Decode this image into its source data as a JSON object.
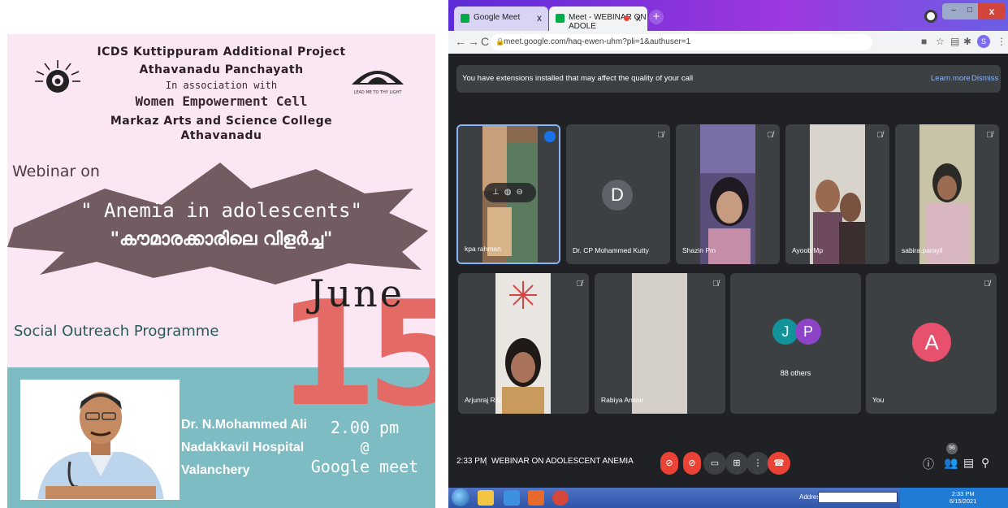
{
  "poster": {
    "line1": "ICDS Kuttippuram Additional Project",
    "line2": "Athavanadu Panchayath",
    "line3": "In association with",
    "line4": "Women Empowerment Cell",
    "line5": "Markaz Arts and Science College",
    "line6": "Athavanadu",
    "logo_right_text": "LEAD ME TO THY LIGHT",
    "webinar_on": "Webinar on",
    "topic_en": "\" Anemia in adolescents\"",
    "topic_ml": "\"കൗമാരക്കാരിലെ  വിളർച്ച\"",
    "month": "June",
    "day": "15",
    "outreach": "Social Outreach Programme",
    "doctor_name": "Dr. N.Mohammed Ali",
    "hospital": "Nadakkavil Hospital",
    "place": "Valanchery",
    "time": "2.00 pm",
    "at": "@",
    "platform": "Google meet",
    "colors": {
      "background": "#fbe6f3",
      "teal": "#7ebcc4",
      "accent": "#e46a66"
    }
  },
  "browser": {
    "tabs": [
      {
        "label": "Google Meet",
        "close": "x",
        "icon": "meet-favicon"
      },
      {
        "label": "Meet - WEBINAR ON ADOLE",
        "close": "x",
        "icon": "meet-favicon",
        "recording": true
      }
    ],
    "new_tab": "+",
    "url": "meet.google.com/haq-ewen-uhm?pli=1&authuser=1",
    "avatar_letter": "S",
    "window_controls": {
      "minimize": "–",
      "maximize": "□",
      "close": "x"
    }
  },
  "meet": {
    "banner": {
      "text": "You have extensions installed that may affect the quality of your call",
      "learn_more": "Learn more",
      "dismiss": "Dismiss"
    },
    "tiles_row1": [
      {
        "name": "kpa rahman",
        "speaking": true
      },
      {
        "name": "Dr. CP Mohammed Kutty",
        "letter": "D",
        "letter_color": "#5f6368"
      },
      {
        "name": "Shazin Pm"
      },
      {
        "name": "Ayoob Mp"
      },
      {
        "name": "sabira parayil"
      }
    ],
    "tiles_row2": [
      {
        "name": "Arjunraj Raj"
      },
      {
        "name": "Rabiya Anwar"
      },
      {
        "name": "",
        "letters": [
          "J",
          "P"
        ],
        "others": "88 others"
      },
      {
        "name": "You",
        "letter": "A",
        "letter_color": "#e8516d"
      }
    ],
    "footer": {
      "time": "2:33 PM",
      "separator": "|",
      "title": "WEBINAR ON ADOLESCENT ANEMIA",
      "people_count": "96"
    }
  },
  "taskbar": {
    "address_label": "Address",
    "clock_time": "2:33 PM",
    "clock_date": "6/15/2021"
  }
}
